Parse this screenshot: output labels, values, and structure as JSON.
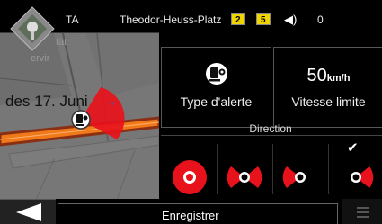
{
  "status_bar": {
    "left_label": "TA",
    "street": "Theodor-Heuss-Platz",
    "badges": [
      "2",
      "5"
    ],
    "count": "0"
  },
  "map": {
    "street_label": "des 17. Juni",
    "faint_labels": [
      "tät",
      "ervir"
    ]
  },
  "alert_type": {
    "label": "Type d'alerte"
  },
  "speed_limit": {
    "value": "50",
    "unit": "km/h",
    "label": "Vitesse limite"
  },
  "direction": {
    "label": "Direction",
    "options": [
      {
        "name": "one-way",
        "selected": false
      },
      {
        "name": "both-directions",
        "selected": false
      },
      {
        "name": "opposite",
        "selected": false
      },
      {
        "name": "forward",
        "selected": true
      }
    ]
  },
  "footer": {
    "save_label": "Enregistrer"
  },
  "colors": {
    "accent_red": "#e8121c",
    "badge_yellow": "#f0d400",
    "route_orange": "#f07a1a"
  },
  "icons": {
    "back": "back-arrow-icon",
    "menu": "menu-icon",
    "sound": "speaker-icon",
    "check": "check-icon",
    "camera": "speed-camera-icon"
  }
}
